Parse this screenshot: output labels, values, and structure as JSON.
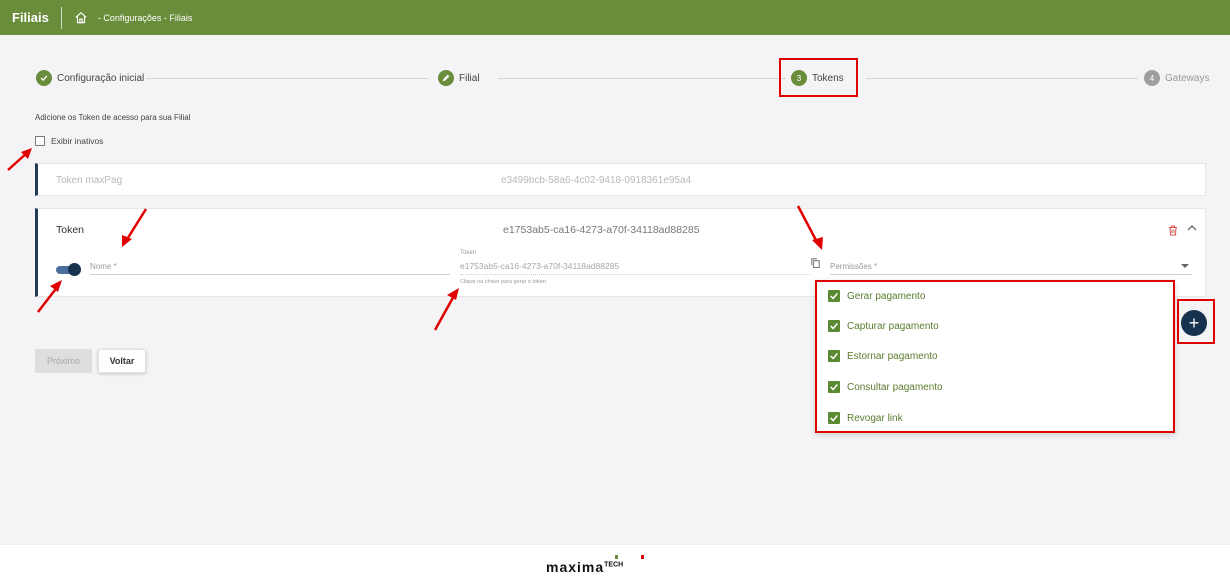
{
  "header": {
    "title": "Filiais",
    "home_icon": "home-icon",
    "breadcrumb": "- Configurações - Filiais",
    "bg_color": "#6a8d3c"
  },
  "stepper": {
    "steps": [
      {
        "label": "Configuração inicial",
        "state": "done",
        "number": ""
      },
      {
        "label": "Filial",
        "state": "edit",
        "number": ""
      },
      {
        "label": "Tokens",
        "state": "active",
        "number": "3"
      },
      {
        "label": "Gateways",
        "state": "pending",
        "number": "4"
      }
    ]
  },
  "intro_text": "Adicione os Token de acesso para sua Filial",
  "show_inactive": {
    "label": "Exibir inativos",
    "checked": false
  },
  "tokens": [
    {
      "label": "Token maxPag",
      "value": "e3499bcb-58a6-4c02-9418-0918361e95a4",
      "disabled": true
    },
    {
      "label": "Token",
      "value": "e1753ab5-ca16-4273-a70f-34118ad88285",
      "active": true,
      "name_placeholder": "Nome *",
      "token_field_label": "Token",
      "token_field_value": "e1753ab5-ca16-4273-a70f-34118ad88285",
      "token_hint": "Clique na chave para gerar o token",
      "permissions_placeholder": "Permissões *"
    }
  ],
  "permissions_options": [
    {
      "label": "Gerar pagamento",
      "checked": true
    },
    {
      "label": "Capturar pagamento",
      "checked": true
    },
    {
      "label": "Estornar pagamento",
      "checked": true
    },
    {
      "label": "Consultar pagamento",
      "checked": true
    },
    {
      "label": "Revogar link",
      "checked": true
    }
  ],
  "fab": {
    "label": "+",
    "icon": "plus-icon"
  },
  "buttons": {
    "next": "Próximo",
    "back": "Voltar"
  },
  "footer": {
    "logo_text": "maxima",
    "logo_suffix": "TECH"
  },
  "colors": {
    "accent": "#6a8d3c",
    "dark": "#17324f",
    "annotation": "#e00000"
  }
}
